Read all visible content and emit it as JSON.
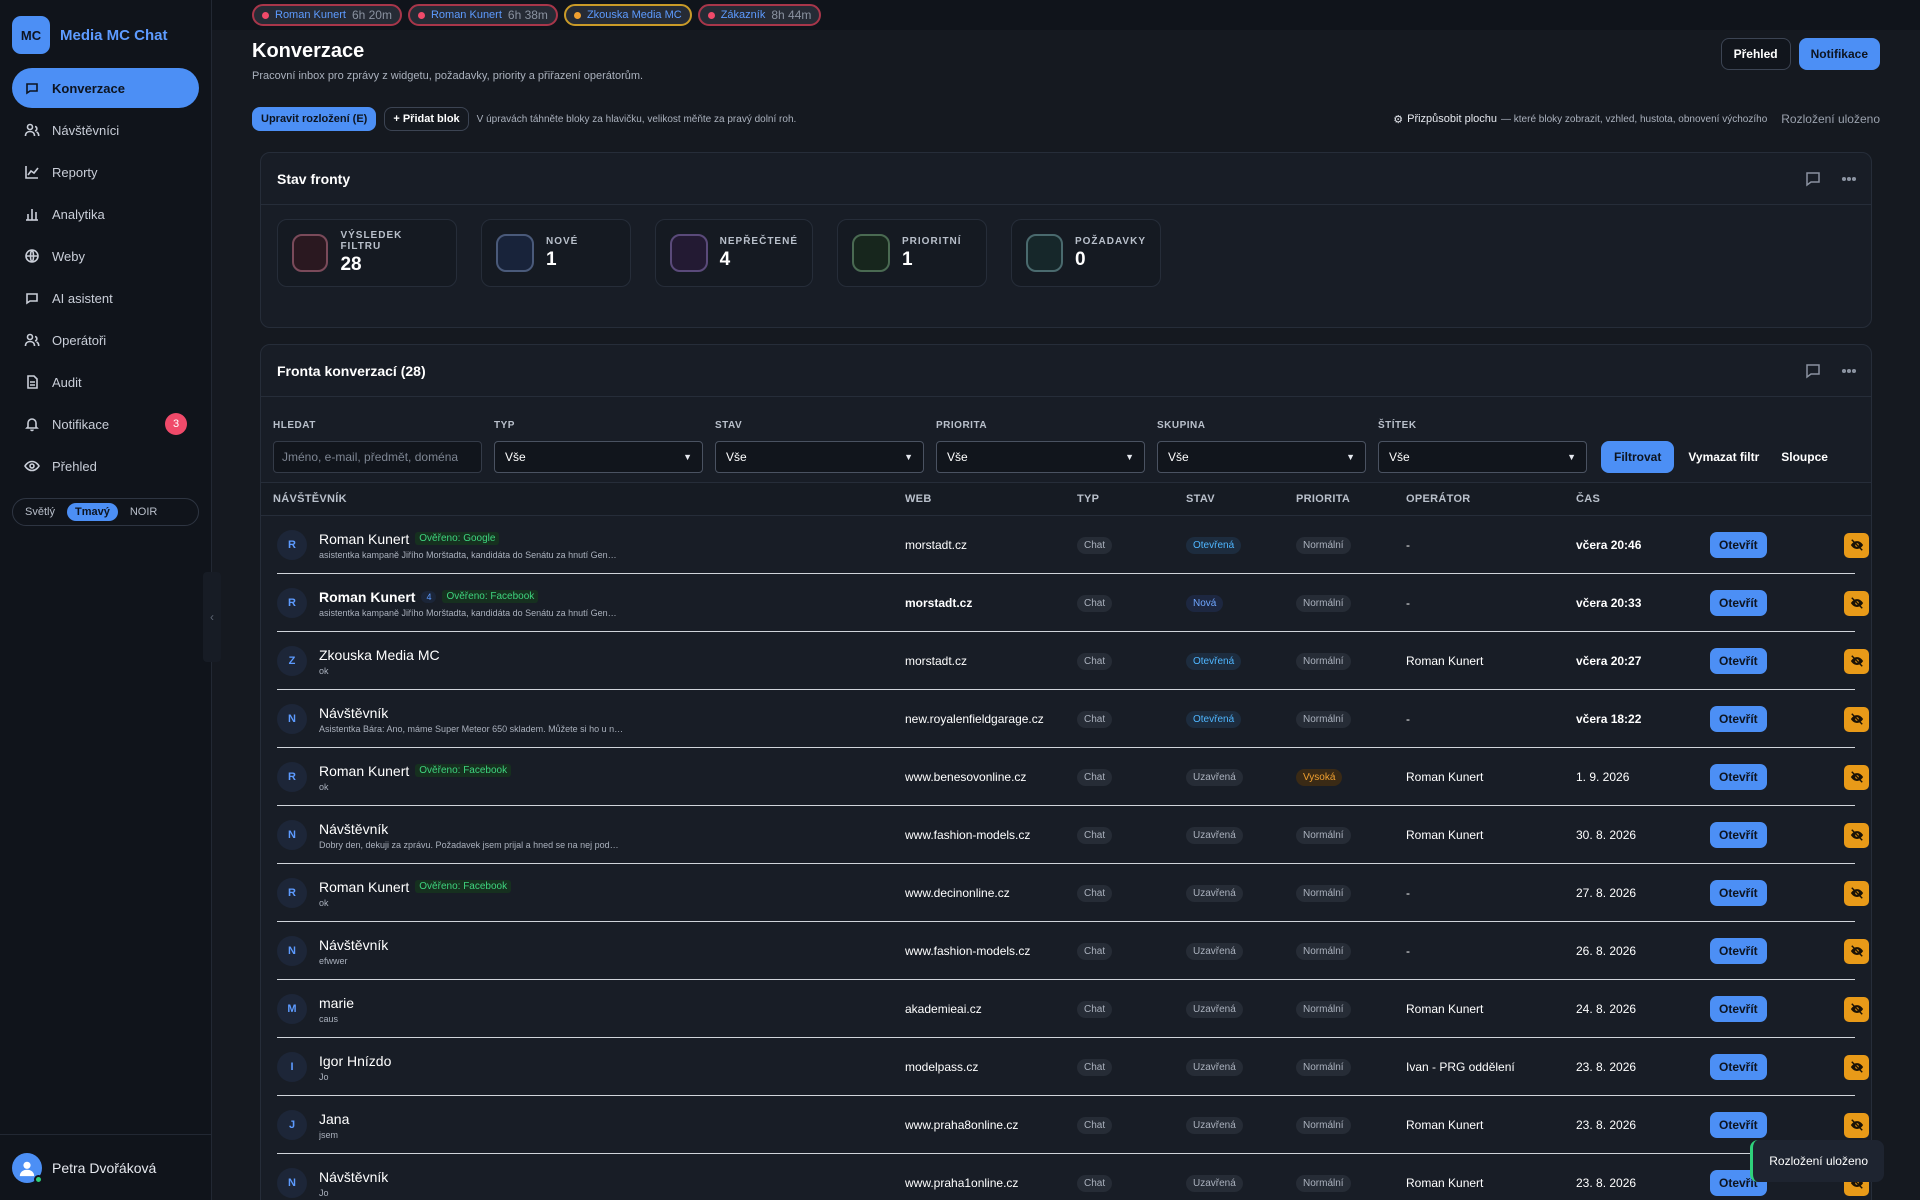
{
  "app": {
    "logo": "MC",
    "name": "Media MC Chat"
  },
  "sidebar": {
    "items": [
      {
        "label": "Konverzace",
        "icon": "chat-bubble-icon",
        "active": true
      },
      {
        "label": "Návštěvníci",
        "icon": "users-icon"
      },
      {
        "label": "Reporty",
        "icon": "line-chart-icon"
      },
      {
        "label": "Analytika",
        "icon": "bar-chart-icon"
      },
      {
        "label": "Weby",
        "icon": "globe-icon"
      },
      {
        "label": "AI asistent",
        "icon": "chat-bubble-icon"
      },
      {
        "label": "Operátoři",
        "icon": "users-icon"
      },
      {
        "label": "Audit",
        "icon": "document-icon"
      },
      {
        "label": "Notifikace",
        "icon": "bell-icon",
        "badge": "3"
      },
      {
        "label": "Přehled",
        "icon": "eye-icon"
      }
    ],
    "theme": {
      "light": "Světlý",
      "dark": "Tmavý",
      "noir": "NOIR"
    },
    "collapse_glyph": "‹",
    "user": {
      "name": "Petra Dvořáková"
    }
  },
  "open_tabs": [
    {
      "name": "Roman Kunert",
      "time": "6h 20m",
      "color": "red"
    },
    {
      "name": "Roman Kunert",
      "time": "6h 38m",
      "color": "red"
    },
    {
      "name": "Zkouska Media MC",
      "time": "",
      "color": "amber"
    },
    {
      "name": "Zákazník",
      "time": "8h 44m",
      "color": "red"
    }
  ],
  "header": {
    "title": "Konverzace",
    "subtitle": "Pracovní inbox pro zprávy z widgetu, požadavky, priority a přiřazení operátorům.",
    "btn_overview": "Přehled",
    "btn_notifications": "Notifikace"
  },
  "toolbar": {
    "edit_layout": "Upravit rozložení (E)",
    "add_block": "+ Přidat blok",
    "hint": "V úpravách táhněte bloky za hlavičku, velikost měňte za pravý dolní roh.",
    "customize": "Přizpůsobit plochu",
    "customize_sub": "— které bloky zobrazit, vzhled, hustota, obnovení výchozího",
    "saved": "Rozložení uloženo"
  },
  "queue_status": {
    "title": "Stav fronty",
    "stats": [
      {
        "label": "VÝSLEDEK FILTRU",
        "value": "28",
        "color": "#2a1820",
        "border": "#7a4a5a"
      },
      {
        "label": "NOVÉ",
        "value": "1",
        "color": "#18233a",
        "border": "#4a5a7a"
      },
      {
        "label": "NEPŘEČTENÉ",
        "value": "4",
        "color": "#231a33",
        "border": "#5a4a7a"
      },
      {
        "label": "PRIORITNÍ",
        "value": "1",
        "color": "#17261d",
        "border": "#4a6a52"
      },
      {
        "label": "POŽADAVKY",
        "value": "0",
        "color": "#16272a",
        "border": "#4a6a6e"
      }
    ]
  },
  "queue": {
    "title": "Fronta konverzací (28)",
    "filters": {
      "search_label": "HLEDAT",
      "search_placeholder": "Jméno, e-mail, předmět, doména",
      "selects": [
        {
          "label": "TYP",
          "value": "Vše"
        },
        {
          "label": "STAV",
          "value": "Vše"
        },
        {
          "label": "PRIORITA",
          "value": "Vše"
        },
        {
          "label": "SKUPINA",
          "value": "Vše"
        },
        {
          "label": "ŠTÍTEK",
          "value": "Vše"
        }
      ],
      "btn_filter": "Filtrovat",
      "btn_clear": "Vymazat filtr",
      "btn_columns": "Sloupce"
    },
    "columns": [
      "NÁVŠTĚVNÍK",
      "WEB",
      "TYP",
      "STAV",
      "PRIORITA",
      "OPERÁTOR",
      "ČAS"
    ],
    "open_label": "Otevřít",
    "rows": [
      {
        "initial": "R",
        "name": "Roman Kunert",
        "bold": false,
        "verified": "Ověřeno: Google",
        "count": "",
        "sub": "asistentka kampaně Jiřího Morštadta, kandidáta do Senátu za hnutí Gen…",
        "web": "morstadt.cz",
        "type": "Chat",
        "status": "Otevřená",
        "status_kind": "open",
        "priority": "Normální",
        "priority_kind": "normal",
        "operator": "-",
        "time": "včera 20:46"
      },
      {
        "initial": "R",
        "name": "Roman Kunert",
        "bold": true,
        "verified": "Ověřeno: Facebook",
        "count": "4",
        "sub": "asistentka kampaně Jiřího Morštadta, kandidáta do Senátu za hnutí Gen…",
        "web": "morstadt.cz",
        "type": "Chat",
        "status": "Nová",
        "status_kind": "new",
        "priority": "Normální",
        "priority_kind": "normal",
        "operator": "-",
        "time": "včera 20:33"
      },
      {
        "initial": "Z",
        "name": "Zkouska Media MC",
        "bold": false,
        "verified": "",
        "count": "",
        "sub": "ok",
        "web": "morstadt.cz",
        "type": "Chat",
        "status": "Otevřená",
        "status_kind": "open",
        "priority": "Normální",
        "priority_kind": "normal",
        "operator": "Roman Kunert",
        "time": "včera 20:27"
      },
      {
        "initial": "N",
        "name": "Návštěvník",
        "bold": false,
        "verified": "",
        "count": "",
        "sub": "Asistentka Bára: Ano, máme Super Meteor 650 skladem. Můžete si ho u n…",
        "web": "new.royalenfieldgarage.cz",
        "type": "Chat",
        "status": "Otevřená",
        "status_kind": "open",
        "priority": "Normální",
        "priority_kind": "normal",
        "operator": "-",
        "time": "včera 18:22"
      },
      {
        "initial": "R",
        "name": "Roman Kunert",
        "bold": false,
        "verified": "Ověřeno: Facebook",
        "count": "",
        "sub": "ok",
        "web": "www.benesovonline.cz",
        "type": "Chat",
        "status": "Uzavřená",
        "status_kind": "closed",
        "priority": "Vysoká",
        "priority_kind": "high",
        "operator": "Roman Kunert",
        "time": "1. 9. 2026"
      },
      {
        "initial": "N",
        "name": "Návštěvník",
        "bold": false,
        "verified": "",
        "count": "",
        "sub": "Dobry den, dekuji za zprávu. Požadavek jsem prijal a hned se na nej pod…",
        "web": "www.fashion-models.cz",
        "type": "Chat",
        "status": "Uzavřená",
        "status_kind": "closed",
        "priority": "Normální",
        "priority_kind": "normal",
        "operator": "Roman Kunert",
        "time": "30. 8. 2026"
      },
      {
        "initial": "R",
        "name": "Roman Kunert",
        "bold": false,
        "verified": "Ověřeno: Facebook",
        "count": "",
        "sub": "ok",
        "web": "www.decinonline.cz",
        "type": "Chat",
        "status": "Uzavřená",
        "status_kind": "closed",
        "priority": "Normální",
        "priority_kind": "normal",
        "operator": "-",
        "time": "27. 8. 2026"
      },
      {
        "initial": "N",
        "name": "Návštěvník",
        "bold": false,
        "verified": "",
        "count": "",
        "sub": "efwwer",
        "web": "www.fashion-models.cz",
        "type": "Chat",
        "status": "Uzavřená",
        "status_kind": "closed",
        "priority": "Normální",
        "priority_kind": "normal",
        "operator": "-",
        "time": "26. 8. 2026"
      },
      {
        "initial": "M",
        "name": "marie",
        "bold": false,
        "verified": "",
        "count": "",
        "sub": "caus",
        "web": "akademieai.cz",
        "type": "Chat",
        "status": "Uzavřená",
        "status_kind": "closed",
        "priority": "Normální",
        "priority_kind": "normal",
        "operator": "Roman Kunert",
        "time": "24. 8. 2026"
      },
      {
        "initial": "I",
        "name": "Igor Hnízdo",
        "bold": false,
        "verified": "",
        "count": "",
        "sub": "Jo",
        "web": "modelpass.cz",
        "type": "Chat",
        "status": "Uzavřená",
        "status_kind": "closed",
        "priority": "Normální",
        "priority_kind": "normal",
        "operator": "Ivan - PRG oddělení",
        "time": "23. 8. 2026"
      },
      {
        "initial": "J",
        "name": "Jana",
        "bold": false,
        "verified": "",
        "count": "",
        "sub": "jsem",
        "web": "www.praha8online.cz",
        "type": "Chat",
        "status": "Uzavřená",
        "status_kind": "closed",
        "priority": "Normální",
        "priority_kind": "normal",
        "operator": "Roman Kunert",
        "time": "23. 8. 2026"
      },
      {
        "initial": "N",
        "name": "Návštěvník",
        "bold": false,
        "verified": "",
        "count": "",
        "sub": "Jo",
        "web": "www.praha1online.cz",
        "type": "Chat",
        "status": "Uzavřená",
        "status_kind": "closed",
        "priority": "Normální",
        "priority_kind": "normal",
        "operator": "Roman Kunert",
        "time": "23. 8. 2026"
      }
    ]
  },
  "toast": "Rozložení uloženo"
}
